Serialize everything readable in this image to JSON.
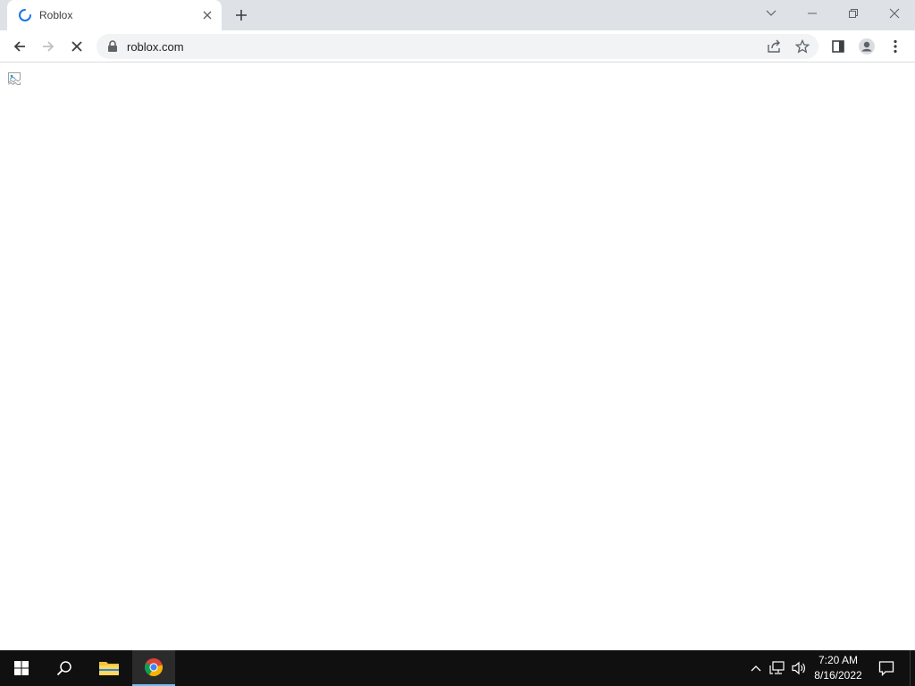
{
  "browser": {
    "tab": {
      "title": "Roblox",
      "state": "loading",
      "icon": "loading-spinner-icon"
    },
    "new_tab_icon": "plus-icon",
    "window_controls": [
      "chevron-down-icon",
      "minimize-icon",
      "restore-icon",
      "close-icon"
    ],
    "toolbar": {
      "back_icon": "arrow-left-icon",
      "forward_icon": "arrow-right-icon",
      "stop_icon": "stop-x-icon",
      "url": "roblox.com",
      "lock_icon": "lock-icon",
      "share_icon": "share-icon",
      "bookmark_icon": "star-icon",
      "side_panel_icon": "side-panel-icon",
      "profile_icon": "profile-icon",
      "menu_icon": "kebab-menu-icon"
    }
  },
  "page": {
    "broken_image_icon": "broken-image-icon"
  },
  "taskbar": {
    "items": [
      "windows-start-icon",
      "search-icon",
      "file-explorer-icon",
      "chrome-icon"
    ],
    "active_item": "chrome-icon",
    "tray": [
      "chevron-up-icon",
      "network-icon",
      "volume-icon",
      "notification-icon"
    ],
    "clock": {
      "time": "7:20 AM",
      "date": "8/16/2022"
    }
  },
  "colors": {
    "tabstrip": "#dee1e6",
    "omnibox": "#f1f3f4",
    "taskbar": "#101010",
    "accent": "#1a73e8"
  }
}
